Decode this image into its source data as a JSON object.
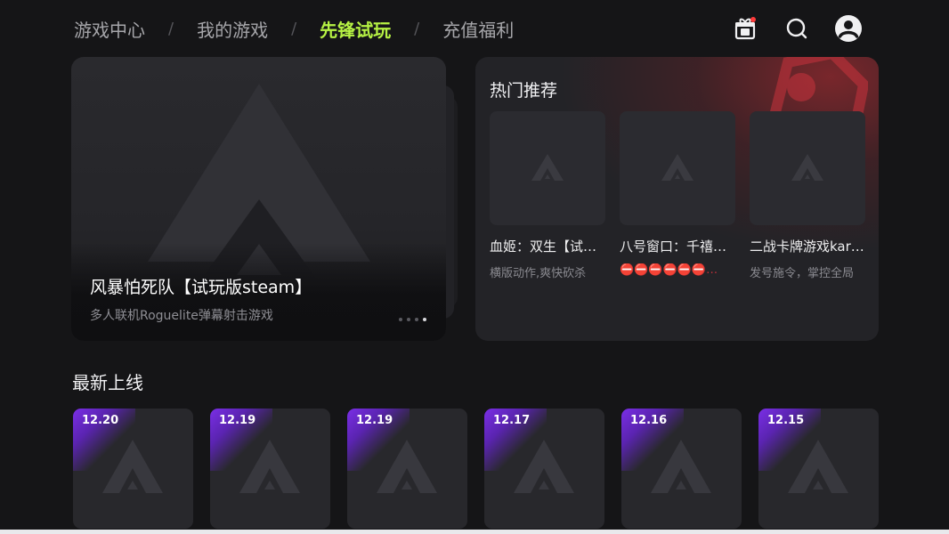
{
  "nav": {
    "tabs": [
      {
        "label": "游戏中心"
      },
      {
        "label": "我的游戏"
      },
      {
        "label": "先锋试玩"
      },
      {
        "label": "充值福利"
      }
    ],
    "separator": "/",
    "active_index": 2,
    "active_color": "#b6f244",
    "icons": [
      "gift-icon",
      "search-icon",
      "user-avatar-icon"
    ]
  },
  "banner": {
    "title": "风暴怕死队【试玩版steam】",
    "subtitle": "多人联机Roguelite弹幕射击游戏",
    "page_count": 4,
    "current_page": 4
  },
  "hot": {
    "title": "热门推荐",
    "items": [
      {
        "name": "血姬：双生【试…",
        "desc": "横版动作,爽快砍杀"
      },
      {
        "name": "八号窗口：千禧…",
        "desc": "⛔⛔⛔⛔⛔⛔…"
      },
      {
        "name": "二战卡牌游戏kar…",
        "desc": "发号施令，掌控全局"
      }
    ],
    "accent_color": "#962830"
  },
  "new_section": {
    "title": "最新上线",
    "items": [
      {
        "date": "12.20"
      },
      {
        "date": "12.19"
      },
      {
        "date": "12.19"
      },
      {
        "date": "12.17"
      },
      {
        "date": "12.16"
      },
      {
        "date": "12.15"
      }
    ],
    "badge_color": "#7a2ee6"
  }
}
